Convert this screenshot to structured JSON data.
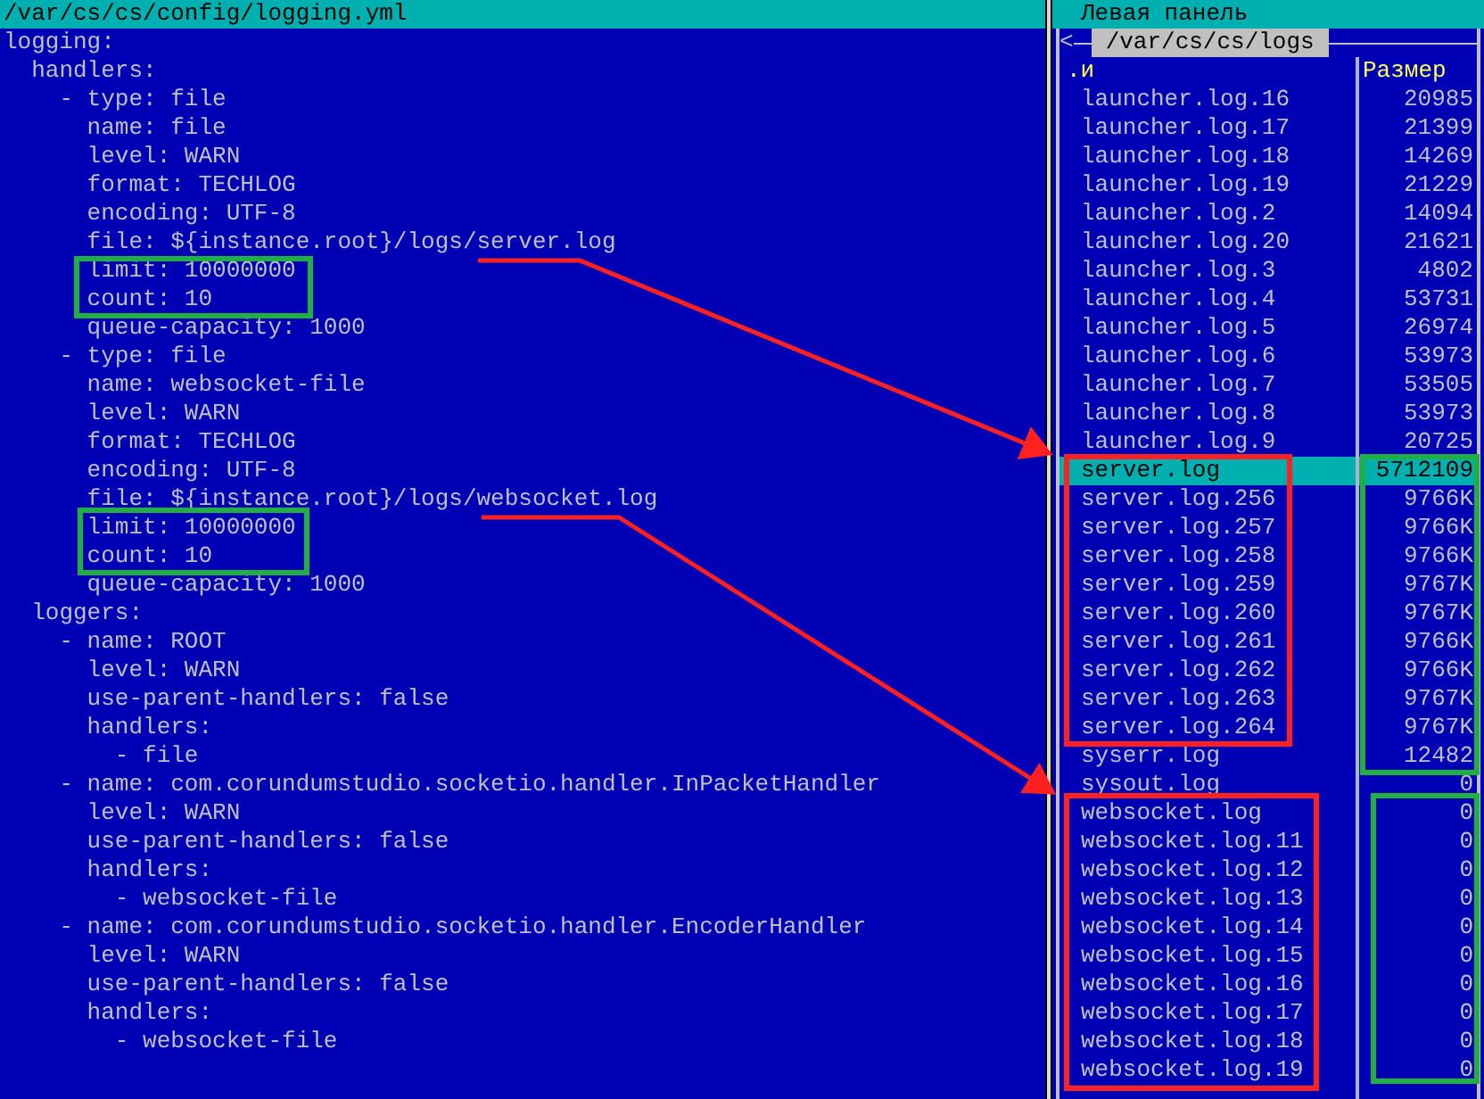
{
  "editor": {
    "path": "/var/cs/cs/config/logging.yml",
    "lines": [
      "logging:",
      "  handlers:",
      "    - type: file",
      "      name: file",
      "      level: WARN",
      "      format: TECHLOG",
      "      encoding: UTF-8",
      "      file: ${instance.root}/logs/server.log",
      "      limit: 10000000",
      "      count: 10",
      "      queue-capacity: 1000",
      "    - type: file",
      "      name: websocket-file",
      "      level: WARN",
      "      format: TECHLOG",
      "      encoding: UTF-8",
      "      file: ${instance.root}/logs/websocket.log",
      "      limit: 10000000",
      "      count: 10",
      "      queue-capacity: 1000",
      "  loggers:",
      "    - name: ROOT",
      "      level: WARN",
      "      use-parent-handlers: false",
      "      handlers:",
      "        - file",
      "    - name: com.corundumstudio.socketio.handler.InPacketHandler",
      "      level: WARN",
      "      use-parent-handlers: false",
      "      handlers:",
      "        - websocket-file",
      "    - name: com.corundumstudio.socketio.handler.EncoderHandler",
      "      level: WARN",
      "      use-parent-handlers: false",
      "      handlers:",
      "        - websocket-file"
    ]
  },
  "panel": {
    "title": "Левая панель",
    "back": "<",
    "path": "/var/cs/cs/logs",
    "columns": [
      ".и",
      "Размер"
    ],
    "files": [
      {
        "name": "launcher.log.16",
        "size": "20985",
        "selected": false
      },
      {
        "name": "launcher.log.17",
        "size": "21399",
        "selected": false
      },
      {
        "name": "launcher.log.18",
        "size": "14269",
        "selected": false
      },
      {
        "name": "launcher.log.19",
        "size": "21229",
        "selected": false
      },
      {
        "name": "launcher.log.2",
        "size": "14094",
        "selected": false
      },
      {
        "name": "launcher.log.20",
        "size": "21621",
        "selected": false
      },
      {
        "name": "launcher.log.3",
        "size": "4802",
        "selected": false
      },
      {
        "name": "launcher.log.4",
        "size": "53731",
        "selected": false
      },
      {
        "name": "launcher.log.5",
        "size": "26974",
        "selected": false
      },
      {
        "name": "launcher.log.6",
        "size": "53973",
        "selected": false
      },
      {
        "name": "launcher.log.7",
        "size": "53505",
        "selected": false
      },
      {
        "name": "launcher.log.8",
        "size": "53973",
        "selected": false
      },
      {
        "name": "launcher.log.9",
        "size": "20725",
        "selected": false
      },
      {
        "name": "server.log",
        "size": "5712109",
        "selected": true
      },
      {
        "name": "server.log.256",
        "size": "9766K",
        "selected": false
      },
      {
        "name": "server.log.257",
        "size": "9766K",
        "selected": false
      },
      {
        "name": "server.log.258",
        "size": "9766K",
        "selected": false
      },
      {
        "name": "server.log.259",
        "size": "9767K",
        "selected": false
      },
      {
        "name": "server.log.260",
        "size": "9767K",
        "selected": false
      },
      {
        "name": "server.log.261",
        "size": "9766K",
        "selected": false
      },
      {
        "name": "server.log.262",
        "size": "9766K",
        "selected": false
      },
      {
        "name": "server.log.263",
        "size": "9767K",
        "selected": false
      },
      {
        "name": "server.log.264",
        "size": "9767K",
        "selected": false
      },
      {
        "name": "syserr.log",
        "size": "12482",
        "selected": false
      },
      {
        "name": "sysout.log",
        "size": "0",
        "selected": false
      },
      {
        "name": "websocket.log",
        "size": "0",
        "selected": false
      },
      {
        "name": "websocket.log.11",
        "size": "0",
        "selected": false
      },
      {
        "name": "websocket.log.12",
        "size": "0",
        "selected": false
      },
      {
        "name": "websocket.log.13",
        "size": "0",
        "selected": false
      },
      {
        "name": "websocket.log.14",
        "size": "0",
        "selected": false
      },
      {
        "name": "websocket.log.15",
        "size": "0",
        "selected": false
      },
      {
        "name": "websocket.log.16",
        "size": "0",
        "selected": false
      },
      {
        "name": "websocket.log.17",
        "size": "0",
        "selected": false
      },
      {
        "name": "websocket.log.18",
        "size": "0",
        "selected": false
      },
      {
        "name": "websocket.log.19",
        "size": "0",
        "selected": false
      }
    ]
  }
}
